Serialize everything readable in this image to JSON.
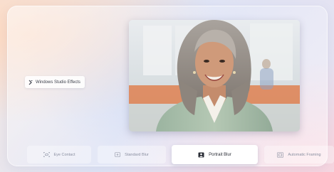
{
  "studio_label": {
    "text": "Windows Studio Effects",
    "icon": "studio-effects-icon"
  },
  "preview": {
    "subject": "webcam-preview-person"
  },
  "effects": [
    {
      "label": "Eye Contact",
      "icon": "eye-contact-icon",
      "active": false
    },
    {
      "label": "Standard Blur",
      "icon": "standard-blur-icon",
      "active": false
    },
    {
      "label": "Portrait Blur",
      "icon": "portrait-blur-icon",
      "active": true
    },
    {
      "label": "Automatic Framing",
      "icon": "automatic-framing-icon",
      "active": false
    }
  ],
  "colors": {
    "accent_active_bg": "#ffffff",
    "inactive_text": "#8a8fa0",
    "active_text": "#2a2d36"
  }
}
